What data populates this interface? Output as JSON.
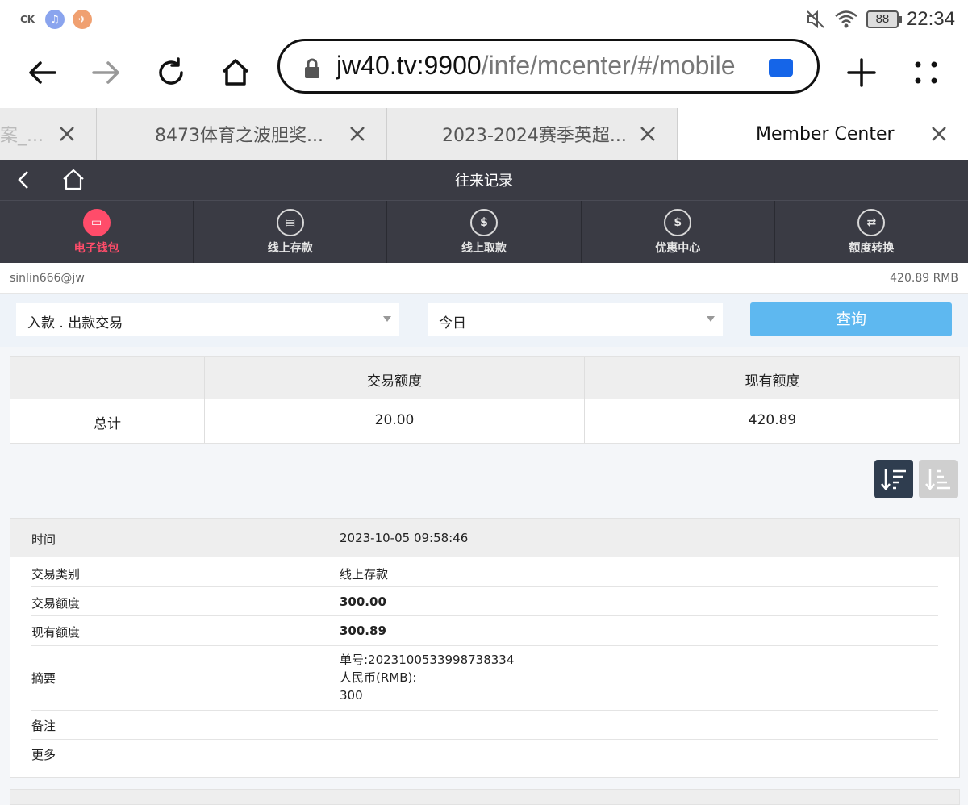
{
  "status_bar": {
    "time": "22:34",
    "battery": "88",
    "left_icons": [
      "ck-icon",
      "music-icon",
      "bird-icon"
    ]
  },
  "browser": {
    "url_host": "jw40.tv:9900",
    "url_path": "/infe/mcenter/#/mobile",
    "tabs": [
      {
        "label": "案_..."
      },
      {
        "label": "8473体育之波胆奖..."
      },
      {
        "label": "2023-2024赛季英超..."
      },
      {
        "label": "Member Center"
      }
    ]
  },
  "app": {
    "title": "往来记录",
    "nav": [
      {
        "label": "电子钱包",
        "icon": "wallet-icon",
        "active": true
      },
      {
        "label": "线上存款",
        "icon": "deposit-icon",
        "active": false
      },
      {
        "label": "线上取款",
        "icon": "withdraw-icon",
        "active": false
      },
      {
        "label": "优惠中心",
        "icon": "promo-icon",
        "active": false
      },
      {
        "label": "额度转换",
        "icon": "transfer-icon",
        "active": false
      }
    ],
    "account": {
      "user": "sinlin666@jw",
      "balance": "420.89 RMB"
    },
    "filters": {
      "type_value": "入款 . 出款交易",
      "date_value": "今日",
      "query_label": "查询"
    },
    "summary": {
      "headers": [
        "",
        "交易额度",
        "现有额度"
      ],
      "row_label": "总计",
      "trade_amount": "20.00",
      "current_amount": "420.89"
    },
    "record": {
      "time_label": "时间",
      "time_value": "2023-10-05 09:58:46",
      "type_label": "交易类别",
      "type_value": "线上存款",
      "amount_label": "交易额度",
      "amount_value": "300.00",
      "balance_label": "现有额度",
      "balance_value": "300.89",
      "summary_label": "摘要",
      "summary_lines": [
        "单号:2023100533998738334",
        "人民币(RMB):",
        "300"
      ],
      "note_label": "备注",
      "more_label": "更多"
    }
  },
  "colors": {
    "header_bg": "#3a3b44",
    "active": "#ff4c6a",
    "query_btn": "#5eb8f0",
    "sort_active": "#2f3d4f"
  }
}
